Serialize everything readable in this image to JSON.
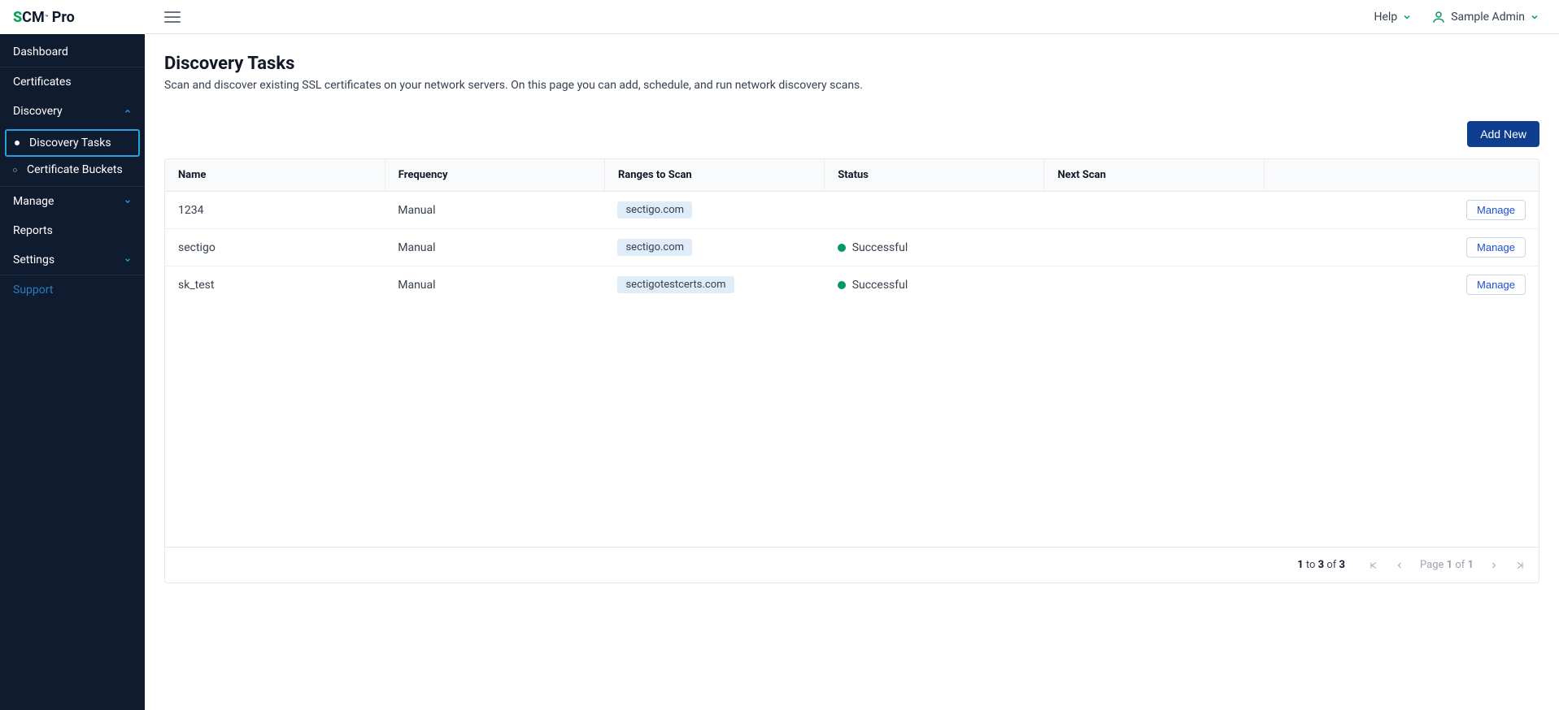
{
  "brand": {
    "prefix": "S",
    "name": "CM",
    "tm": "™",
    "suffix": "Pro"
  },
  "topbar": {
    "help": "Help",
    "username": "Sample Admin"
  },
  "sidebar": {
    "items": [
      {
        "label": "Dashboard"
      },
      {
        "label": "Certificates"
      },
      {
        "label": "Discovery",
        "expanded": true,
        "children": [
          {
            "label": "Discovery Tasks",
            "active": true
          },
          {
            "label": "Certificate Buckets"
          }
        ]
      },
      {
        "label": "Manage",
        "expandable": true
      },
      {
        "label": "Reports"
      },
      {
        "label": "Settings",
        "expandable": true
      }
    ],
    "support": "Support"
  },
  "page": {
    "title": "Discovery Tasks",
    "description": "Scan and discover existing SSL certificates on your network servers. On this page you can add, schedule, and run network discovery scans.",
    "add_button": "Add New"
  },
  "table": {
    "headers": {
      "name": "Name",
      "frequency": "Frequency",
      "ranges": "Ranges to Scan",
      "status": "Status",
      "next_scan": "Next Scan"
    },
    "manage_label": "Manage",
    "rows": [
      {
        "name": "1234",
        "frequency": "Manual",
        "range": "sectigo.com",
        "status": "",
        "next_scan": ""
      },
      {
        "name": "sectigo",
        "frequency": "Manual",
        "range": "sectigo.com",
        "status": "Successful",
        "next_scan": ""
      },
      {
        "name": "sk_test",
        "frequency": "Manual",
        "range": "sectigotestcerts.com",
        "status": "Successful",
        "next_scan": ""
      }
    ]
  },
  "pagination": {
    "from": "1",
    "to": "3",
    "total": "3",
    "range_word_to": "to",
    "range_word_of": "of",
    "page_word": "Page",
    "page_current": "1",
    "page_total": "1"
  }
}
